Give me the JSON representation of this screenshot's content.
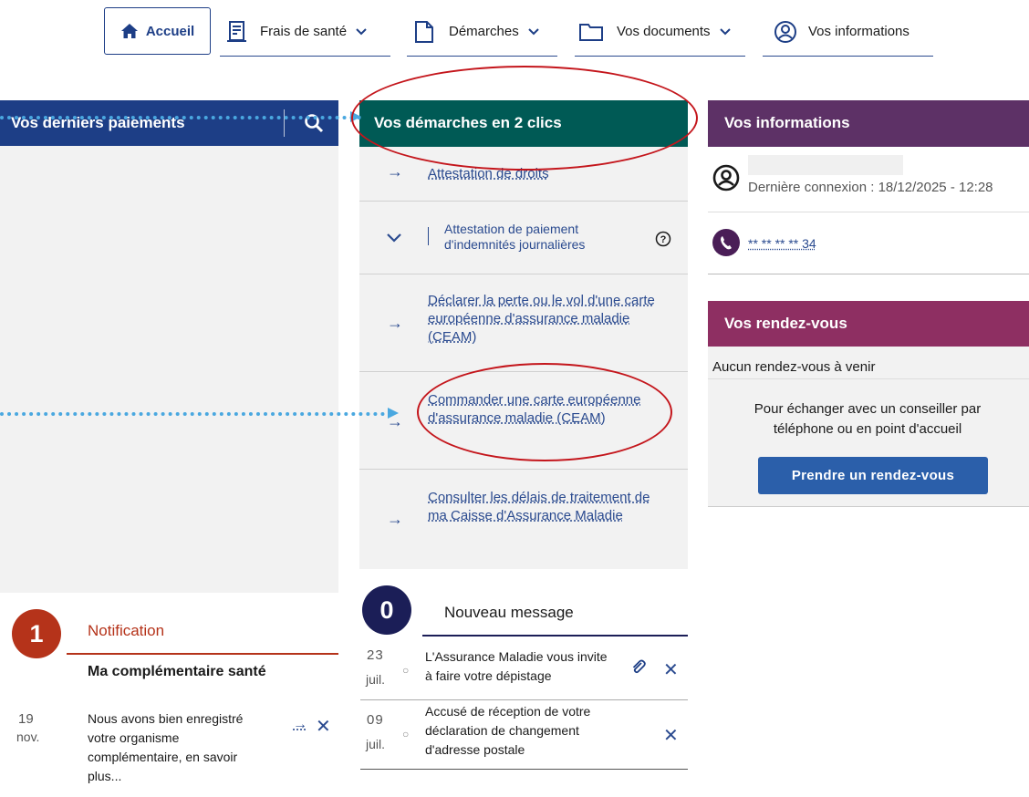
{
  "nav": {
    "home": "Accueil",
    "frais": "Frais de santé",
    "demarches": "Démarches",
    "documents": "Vos documents",
    "informations": "Vos informations"
  },
  "paiements": {
    "title": "Vos derniers paiements"
  },
  "demarches": {
    "title": "Vos démarches en 2 clics",
    "items": [
      {
        "label": "Attestation de droits"
      },
      {
        "label": "Attestation de paiement d'indemnités journalières"
      },
      {
        "label": "Déclarer la perte ou le vol d'une carte européenne d'assurance maladie (CEAM)"
      },
      {
        "label": "Commander une carte européenne d'assurance maladie (CEAM)"
      },
      {
        "label": "Consulter les délais de traitement de ma Caisse d'Assurance Maladie"
      }
    ]
  },
  "informations": {
    "title": "Vos informations",
    "last_login": "Dernière connexion : 18/12/2025 - 12:28",
    "phone": "** ** ** ** 34"
  },
  "rdv": {
    "title": "Vos rendez-vous",
    "none": "Aucun rendez-vous à venir",
    "text": "Pour échanger avec un conseiller par téléphone ou en point d'accueil",
    "button": "Prendre un rendez-vous"
  },
  "notification": {
    "count": "1",
    "title": "Notification",
    "item_title": "Ma complémentaire santé",
    "item_text": "Nous avons bien enregistré votre organisme complémentaire, en savoir plus...",
    "day": "19",
    "month": "nov."
  },
  "messages": {
    "count": "0",
    "title": "Nouveau message",
    "items": [
      {
        "day": "23",
        "month": "juil.",
        "text": "L'Assurance Maladie vous invite à faire votre dépistage"
      },
      {
        "day": "09",
        "month": "juil.",
        "text": "Accusé de réception de votre déclaration de changement d'adresse postale"
      }
    ]
  },
  "colors": {
    "navy": "#1d3e86",
    "teal": "#005a55",
    "purple": "#5d3166",
    "magenta": "#8e2f62",
    "annotation_red": "#c4161c",
    "annotation_blue": "#4aa8e0"
  }
}
